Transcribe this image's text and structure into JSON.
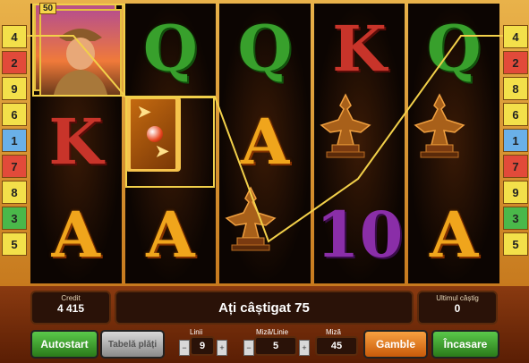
{
  "paylines": {
    "left": [
      {
        "n": "4",
        "c": "#f3e04a"
      },
      {
        "n": "2",
        "c": "#e24a3a"
      },
      {
        "n": "9",
        "c": "#f3e04a"
      },
      {
        "n": "6",
        "c": "#f3e04a"
      },
      {
        "n": "1",
        "c": "#6ab0e8"
      },
      {
        "n": "7",
        "c": "#e24a3a"
      },
      {
        "n": "8",
        "c": "#f3e04a"
      },
      {
        "n": "3",
        "c": "#4ab84a"
      },
      {
        "n": "5",
        "c": "#f3e04a"
      }
    ],
    "right": [
      {
        "n": "4",
        "c": "#f3e04a"
      },
      {
        "n": "2",
        "c": "#e24a3a"
      },
      {
        "n": "8",
        "c": "#f3e04a"
      },
      {
        "n": "6",
        "c": "#f3e04a"
      },
      {
        "n": "1",
        "c": "#6ab0e8"
      },
      {
        "n": "7",
        "c": "#e24a3a"
      },
      {
        "n": "9",
        "c": "#f3e04a"
      },
      {
        "n": "3",
        "c": "#4ab84a"
      },
      {
        "n": "5",
        "c": "#f3e04a"
      }
    ]
  },
  "bet_badge": "50",
  "reels": [
    {
      "symbols": [
        {
          "type": "explorer",
          "label": ""
        },
        {
          "type": "k",
          "label": "K"
        },
        {
          "type": "a",
          "label": "A"
        }
      ]
    },
    {
      "symbols": [
        {
          "type": "q",
          "label": "Q"
        },
        {
          "type": "book",
          "label": ""
        },
        {
          "type": "a",
          "label": "A"
        }
      ]
    },
    {
      "symbols": [
        {
          "type": "q",
          "label": "Q"
        },
        {
          "type": "a",
          "label": "A"
        },
        {
          "type": "statue",
          "label": ""
        }
      ]
    },
    {
      "symbols": [
        {
          "type": "k",
          "label": "K"
        },
        {
          "type": "statue",
          "label": ""
        },
        {
          "type": "ten",
          "label": "10"
        }
      ]
    },
    {
      "symbols": [
        {
          "type": "q",
          "label": "Q"
        },
        {
          "type": "statue",
          "label": ""
        },
        {
          "type": "a",
          "label": "A"
        }
      ]
    }
  ],
  "credit": {
    "label": "Credit",
    "value": "4 415"
  },
  "message": "Ați câștigat 75",
  "last_win": {
    "label": "Ultimul câștig",
    "value": "0"
  },
  "buttons": {
    "autostart": "Autostart",
    "paytable": "Tabelă plăți",
    "gamble": "Gamble",
    "collect": "Încasare"
  },
  "lines": {
    "label": "Linii",
    "value": "9"
  },
  "bet_per_line": {
    "label": "Miză/Linie",
    "value": "5"
  },
  "bet": {
    "label": "Miză",
    "value": "45"
  },
  "colors": {
    "win_highlight": "#f2d04a",
    "autostart": "#3a9a2a",
    "gamble": "#e87a1a",
    "collect": "#3a9a2a"
  }
}
